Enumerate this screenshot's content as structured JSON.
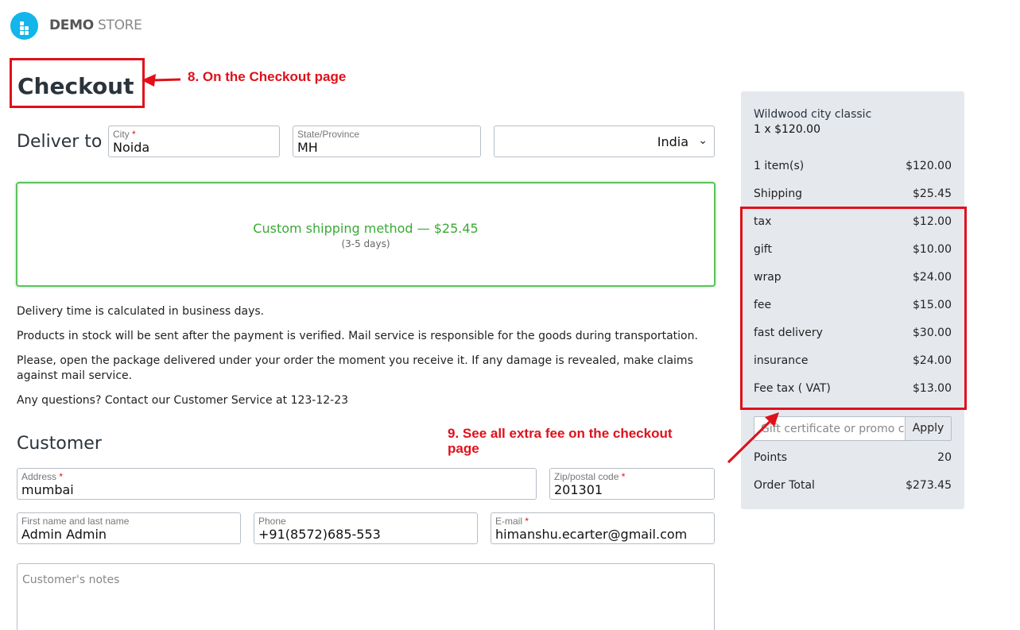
{
  "header": {
    "brand_bold": "DEMO",
    "brand_light": "STORE"
  },
  "page": {
    "title": "Checkout"
  },
  "annotations": {
    "step8": "8. On the Checkout page",
    "step9_line1": "9. See all extra fee on the checkout",
    "step9_line2": "page",
    "color": "#e0101a"
  },
  "deliver": {
    "label": "Deliver to",
    "city_label": "City",
    "city_value": "Noida",
    "state_label": "State/Province",
    "state_value": "MH",
    "country_value": "India"
  },
  "shipping": {
    "method": "Custom shipping method — $25.45",
    "eta": "(3-5 days)"
  },
  "info": [
    "Delivery time is calculated in business days.",
    "Products in stock will be sent after the payment is verified. Mail service is responsible for the goods during transportation.",
    "Please, open the package delivered under your order the moment you receive it. If any damage is revealed, make claims against mail service.",
    "Any questions? Contact our Customer Service at 123-12-23"
  ],
  "customer": {
    "label": "Customer",
    "address_label": "Address",
    "address_value": "mumbai",
    "zip_label": "Zip/postal code",
    "zip_value": "201301",
    "name_label": "First name and last name",
    "name_value": "Admin Admin",
    "phone_label": "Phone",
    "phone_value": "+91(8572)685-553",
    "email_label": "E-mail",
    "email_value": "himanshu.ecarter@gmail.com",
    "notes_placeholder": "Customer's notes"
  },
  "summary": {
    "product_name": "Wildwood city classic",
    "product_qty": "1 x $120.00",
    "rows": [
      {
        "label": "1 item(s)",
        "value": "$120.00"
      },
      {
        "label": "Shipping",
        "value": "$25.45"
      },
      {
        "label": "tax",
        "value": "$12.00"
      },
      {
        "label": "gift",
        "value": "$10.00"
      },
      {
        "label": "wrap",
        "value": "$24.00"
      },
      {
        "label": "fee",
        "value": "$15.00"
      },
      {
        "label": "fast delivery",
        "value": "$30.00"
      },
      {
        "label": "insurance",
        "value": "$24.00"
      },
      {
        "label": "Fee tax ( VAT)",
        "value": "$13.00"
      }
    ],
    "promo_placeholder": "Gift certificate or promo code",
    "apply_label": "Apply",
    "points_label": "Points",
    "points_value": "20",
    "total_label": "Order Total",
    "total_value": "$273.45"
  }
}
